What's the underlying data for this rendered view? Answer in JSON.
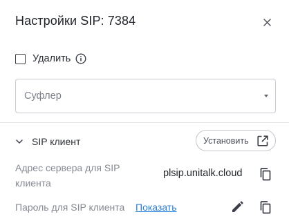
{
  "dialog": {
    "title": "Настройки SIP: 7384",
    "close_icon": "close-icon"
  },
  "delete": {
    "label": "Удалить",
    "checked": false,
    "info_icon": "info-icon"
  },
  "prompter_select": {
    "placeholder": "Суфлер",
    "caret_icon": "caret-down-icon"
  },
  "sip_client": {
    "section_label": "SIP клиент",
    "expanded": true,
    "install_button": "Установить",
    "install_icon": "open-in-new-icon",
    "server_address": {
      "label": "Адрес сервера для SIP клиента",
      "value": "plsip.unitalk.cloud",
      "copy_icon": "copy-icon"
    },
    "password": {
      "label": "Пароль для SIP клиента",
      "show_link": "Показать",
      "edit_icon": "pencil-icon",
      "copy_icon": "copy-icon"
    }
  }
}
